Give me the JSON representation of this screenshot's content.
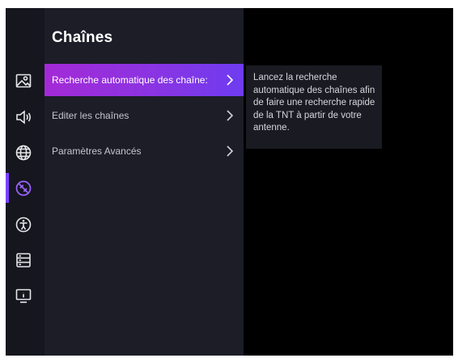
{
  "panel": {
    "title": "Chaînes",
    "items": [
      {
        "label": "Recherche automatique des chaîne:",
        "active": true
      },
      {
        "label": "Editer les chaînes",
        "active": false
      },
      {
        "label": "Paramètres Avancés",
        "active": false
      }
    ]
  },
  "tooltip": {
    "text": "Lancez la recherche automatique des chaînes afin de faire une recherche rapide de la TNT à partir de votre antenne."
  },
  "rail": {
    "icons": [
      "picture-icon",
      "sound-icon",
      "network-globe-icon",
      "channels-icon",
      "accessibility-icon",
      "storage-icon",
      "system-info-icon"
    ],
    "active_icon": "channels-icon"
  },
  "colors": {
    "accent": "#7a42ff",
    "active_gradient_start": "#a32ad6",
    "active_gradient_end": "#6e3cf0",
    "panel_bg": "#1c1d27",
    "rail_bg": "#15161e"
  }
}
